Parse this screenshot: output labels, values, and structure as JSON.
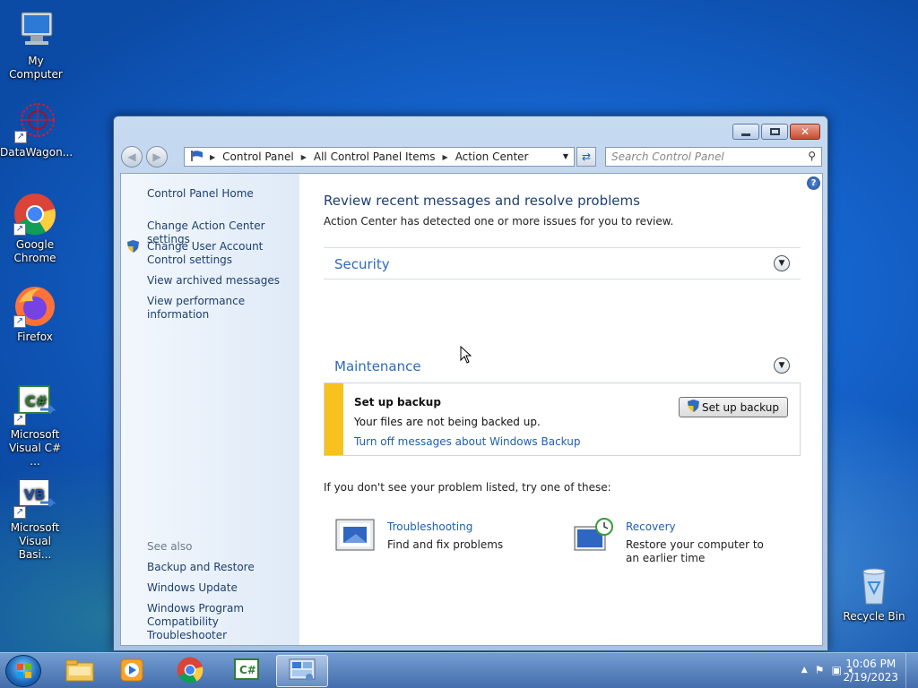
{
  "desktop": {
    "icons": [
      {
        "label": "My Computer"
      },
      {
        "label": "DataWagon..."
      },
      {
        "label": "Google Chrome"
      },
      {
        "label": "Firefox"
      },
      {
        "label": "Microsoft Visual C# ..."
      },
      {
        "label": "Microsoft Visual Basi..."
      },
      {
        "label": "Recycle Bin"
      }
    ]
  },
  "window": {
    "address": {
      "crumbs": [
        "Control Panel",
        "All Control Panel Items",
        "Action Center"
      ]
    },
    "search": {
      "placeholder": "Search Control Panel"
    },
    "sidebar": {
      "home": "Control Panel Home",
      "links": [
        "Change Action Center settings",
        "Change User Account Control settings",
        "View archived messages",
        "View performance information"
      ],
      "see_also_label": "See also",
      "see_also": [
        "Backup and Restore",
        "Windows Update",
        "Windows Program Compatibility Troubleshooter"
      ]
    },
    "content": {
      "title": "Review recent messages and resolve problems",
      "subtitle": "Action Center has detected one or more issues for you to review.",
      "sections": {
        "security": "Security",
        "maintenance": "Maintenance"
      },
      "backup": {
        "heading": "Set up backup",
        "text": "Your files are not being backed up.",
        "link": "Turn off messages about Windows Backup",
        "button": "Set up backup",
        "accent": "#f7c21e"
      },
      "try_text": "If you don't see your problem listed, try one of these:",
      "tools": [
        {
          "link": "Troubleshooting",
          "desc": "Find and fix problems"
        },
        {
          "link": "Recovery",
          "desc": "Restore your computer to an earlier time"
        }
      ]
    }
  },
  "taskbar": {
    "time": "10:06 PM",
    "date": "2/19/2023"
  }
}
